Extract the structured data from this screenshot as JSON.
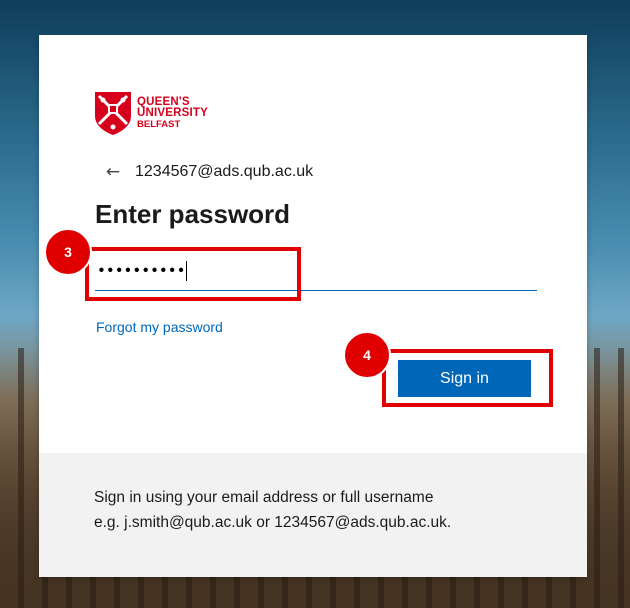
{
  "brand": {
    "line1": "QUEEN'S",
    "line2": "UNIVERSITY",
    "line3": "BELFAST",
    "color": "#d6001c"
  },
  "identity": "1234567@ads.qub.ac.uk",
  "title": "Enter password",
  "password": {
    "masked_value": "••••••••••"
  },
  "forgot_link": "Forgot my password",
  "signin_button": "Sign in",
  "footer": {
    "line1": "Sign in using your email address or full username",
    "line2": "e.g. j.smith@qub.ac.uk or 1234567@ads.qub.ac.uk."
  },
  "annotations": {
    "step3": "3",
    "step4": "4",
    "color": "#e00000"
  },
  "icons": {
    "back": "arrow-left-icon",
    "crest": "university-crest-icon"
  },
  "accent_color": "#0067b8"
}
